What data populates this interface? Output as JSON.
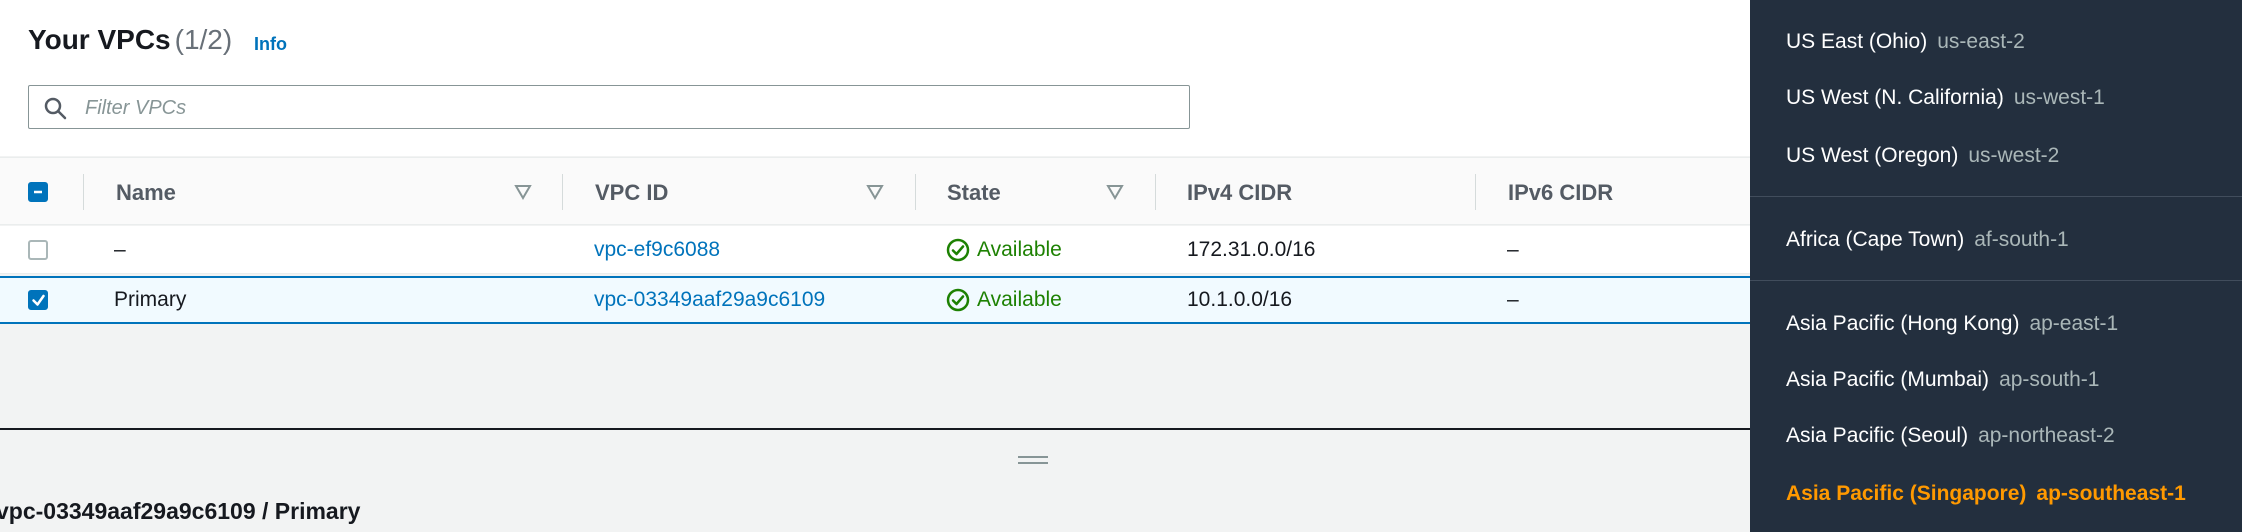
{
  "vpcs": {
    "title": "Your VPCs",
    "count": "(1/2)",
    "info_label": "Info",
    "filter_placeholder": "Filter VPCs",
    "columns": {
      "name": "Name",
      "vpc_id": "VPC ID",
      "state": "State",
      "ipv4": "IPv4 CIDR",
      "ipv6": "IPv6 CIDR"
    },
    "rows": [
      {
        "selected": false,
        "name": "–",
        "vpc_id": "vpc-ef9c6088",
        "state": "Available",
        "ipv4": "172.31.0.0/16",
        "ipv6": "–"
      },
      {
        "selected": true,
        "name": "Primary",
        "vpc_id": "vpc-03349aaf29a9c6109",
        "state": "Available",
        "ipv4": "10.1.0.0/16",
        "ipv6": "–"
      }
    ]
  },
  "details": {
    "title": "vpc-03349aaf29a9c6109 / Primary"
  },
  "regions": [
    {
      "name": "US East (Ohio)",
      "code": "us-east-2",
      "selected": false
    },
    {
      "name": "US West (N. California)",
      "code": "us-west-1",
      "selected": false
    },
    {
      "name": "US West (Oregon)",
      "code": "us-west-2",
      "selected": false
    },
    {
      "name": "Africa (Cape Town)",
      "code": "af-south-1",
      "selected": false
    },
    {
      "name": "Asia Pacific (Hong Kong)",
      "code": "ap-east-1",
      "selected": false
    },
    {
      "name": "Asia Pacific (Mumbai)",
      "code": "ap-south-1",
      "selected": false
    },
    {
      "name": "Asia Pacific (Seoul)",
      "code": "ap-northeast-2",
      "selected": false
    },
    {
      "name": "Asia Pacific (Singapore)",
      "code": "ap-southeast-1",
      "selected": true
    }
  ],
  "colors": {
    "link": "#0073bb",
    "status_ok": "#1d8102",
    "region_panel_bg": "#232f3e",
    "region_selected": "#ff9900"
  }
}
